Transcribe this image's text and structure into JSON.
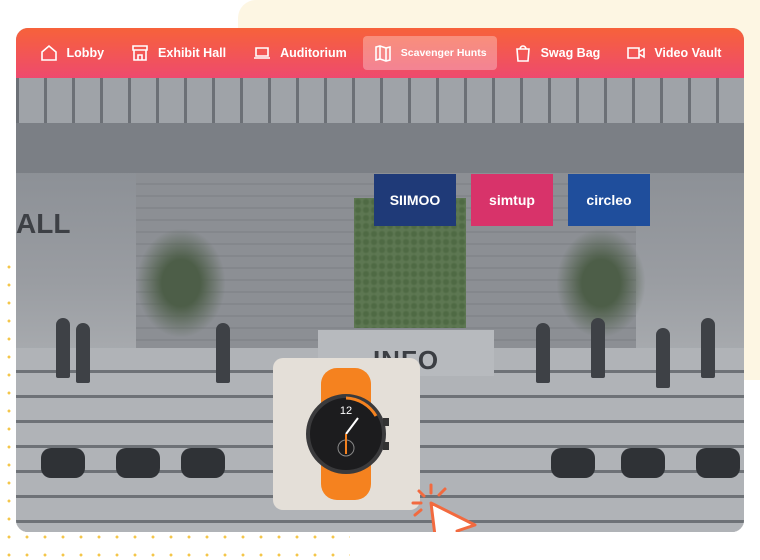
{
  "nav": {
    "items": [
      {
        "label": "Lobby",
        "icon": "home-icon"
      },
      {
        "label": "Exhibit Hall",
        "icon": "store-icon"
      },
      {
        "label": "Auditorium",
        "icon": "laptop-icon"
      },
      {
        "label": "Scavenger Hunts",
        "icon": "map-icon",
        "active": true
      },
      {
        "label": "Swag Bag",
        "icon": "shopping-bag-icon"
      },
      {
        "label": "Video Vault",
        "icon": "video-camera-icon"
      }
    ]
  },
  "scene": {
    "banners": [
      "SIIMOO",
      "simtup",
      "circleo"
    ],
    "desk_sign": "INFO",
    "wall_sign": "ALL"
  },
  "colors": {
    "nav_start": "#f7623a",
    "nav_end": "#ee4a6e",
    "accent": "#f26a3f",
    "watch_strap": "#f5821f"
  }
}
